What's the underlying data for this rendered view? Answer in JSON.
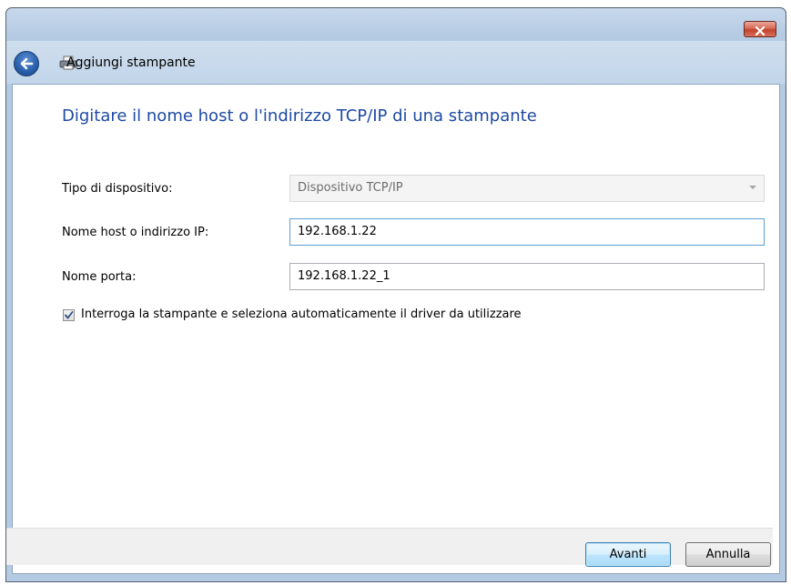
{
  "background_text": "",
  "window": {
    "title": "Aggiungi stampante",
    "close_icon": "close-icon",
    "back_icon": "back-arrow-icon",
    "app_icon": "printer-icon"
  },
  "content": {
    "heading": "Digitare il nome host o l'indirizzo TCP/IP di una stampante",
    "device_type": {
      "label": "Tipo di dispositivo:",
      "value": "Dispositivo TCP/IP"
    },
    "host": {
      "label": "Nome host o indirizzo IP:",
      "value": "192.168.1.22"
    },
    "port": {
      "label": "Nome porta:",
      "value": "192.168.1.22_1"
    },
    "query_printer": {
      "label": "Interroga la stampante e seleziona automaticamente il driver da utilizzare",
      "checked": true
    }
  },
  "footer": {
    "next_label": "Avanti",
    "cancel_label": "Annulla"
  },
  "colors": {
    "heading": "#1e4aa3",
    "close_button": "#c1412b",
    "title_bar": "#b5cbe3"
  }
}
